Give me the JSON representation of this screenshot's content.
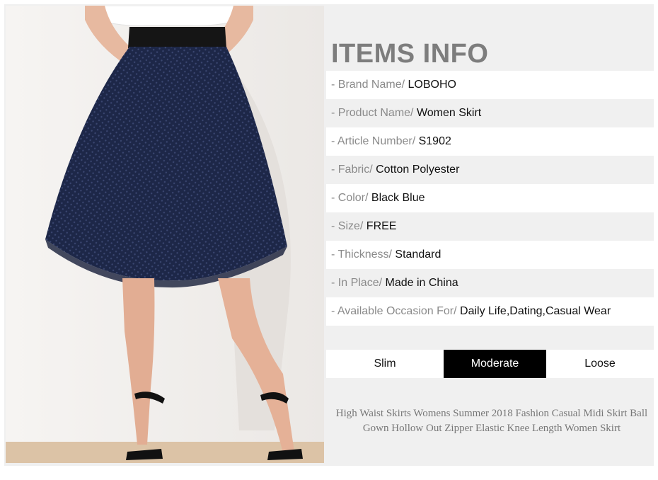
{
  "page": {
    "title": "ITEMS INFO",
    "specs": [
      {
        "key": "- Brand Name/ ",
        "value": "LOBOHO"
      },
      {
        "key": "- Product Name/ ",
        "value": "Women Skirt"
      },
      {
        "key": "- Article Number/ ",
        "value": "S1902"
      },
      {
        "key": "- Fabric/ ",
        "value": "Cotton Polyester"
      },
      {
        "key": "- Color/ ",
        "value": "Black Blue"
      },
      {
        "key": "- Size/ ",
        "value": "FREE"
      },
      {
        "key": "- Thickness/ ",
        "value": "Standard"
      },
      {
        "key": "- In Place/ ",
        "value": "Made in China"
      },
      {
        "key": "- Available Occasion For/ ",
        "value": "Daily Life,Dating,Casual Wear"
      }
    ],
    "fit": {
      "options": [
        "Slim",
        "Moderate",
        "Loose"
      ],
      "selected": "Moderate"
    },
    "description": "High Waist Skirts Womens Summer 2018 Fashion Casual Midi Skirt Ball Gown Hollow Out Zipper Elastic Knee Length Women Skirt"
  },
  "colors": {
    "skirt": "#1d2748",
    "selected_fit": "#000000",
    "title": "#7d7d7d"
  }
}
